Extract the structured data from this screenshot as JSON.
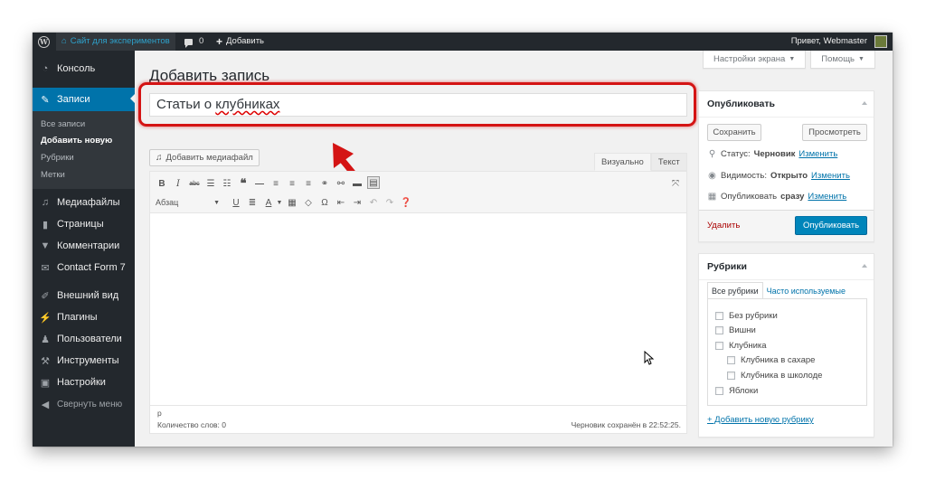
{
  "admin_bar": {
    "site_name": "Сайт для экспериментов",
    "comments_count": "0",
    "add_new": "Добавить",
    "greeting": "Привет, Webmaster"
  },
  "sidebar": {
    "items": [
      {
        "label": "Консоль",
        "icon": "dashboard-icon"
      },
      {
        "label": "Записи",
        "icon": "pin-icon"
      },
      {
        "label": "Медиафайлы",
        "icon": "media-icon"
      },
      {
        "label": "Страницы",
        "icon": "pages-icon"
      },
      {
        "label": "Комментарии",
        "icon": "comments-icon"
      },
      {
        "label": "Contact Form 7",
        "icon": "mail-icon"
      },
      {
        "label": "Внешний вид",
        "icon": "brush-icon"
      },
      {
        "label": "Плагины",
        "icon": "plugin-icon"
      },
      {
        "label": "Пользователи",
        "icon": "users-icon"
      },
      {
        "label": "Инструменты",
        "icon": "wrench-icon"
      },
      {
        "label": "Настройки",
        "icon": "settings-icon"
      }
    ],
    "submenu": [
      "Все записи",
      "Добавить новую",
      "Рубрики",
      "Метки"
    ],
    "collapse_label": "Свернуть меню"
  },
  "header": {
    "page_title": "Добавить запись",
    "screen_options": "Настройки экрана",
    "help": "Помощь"
  },
  "editor": {
    "title_value_plain": "Статьи о ",
    "title_value_misspelled": "клубниках",
    "add_media": "Добавить медиафайл",
    "tab_visual": "Визуально",
    "tab_text": "Текст",
    "format_select": "Абзац",
    "path": "p",
    "word_count": "Количество слов: 0",
    "draft_saved": "Черновик сохранён в 22:52:25."
  },
  "publish_box": {
    "title": "Опубликовать",
    "save": "Сохранить",
    "preview": "Просмотреть",
    "status_label": "Статус:",
    "status_value": "Черновик",
    "visibility_label": "Видимость:",
    "visibility_value": "Открыто",
    "publish_label": "Опубликовать",
    "publish_value": "сразу",
    "edit_link": "Изменить",
    "delete": "Удалить",
    "publish_button": "Опубликовать"
  },
  "categories_box": {
    "title": "Рубрики",
    "tab_all": "Все рубрики",
    "tab_popular": "Часто используемые",
    "items": [
      {
        "label": "Без рубрики",
        "level": 0
      },
      {
        "label": "Вишни",
        "level": 0
      },
      {
        "label": "Клубника",
        "level": 0
      },
      {
        "label": "Клубника в сахаре",
        "level": 1
      },
      {
        "label": "Клубника в школоде",
        "level": 1
      },
      {
        "label": "Яблоки",
        "level": 0
      }
    ],
    "add_new": "+ Добавить новую рубрику"
  },
  "colors": {
    "admin_dark": "#23282d",
    "accent_blue": "#0073aa",
    "primary_button": "#0085ba",
    "highlight_red": "#d41414"
  }
}
